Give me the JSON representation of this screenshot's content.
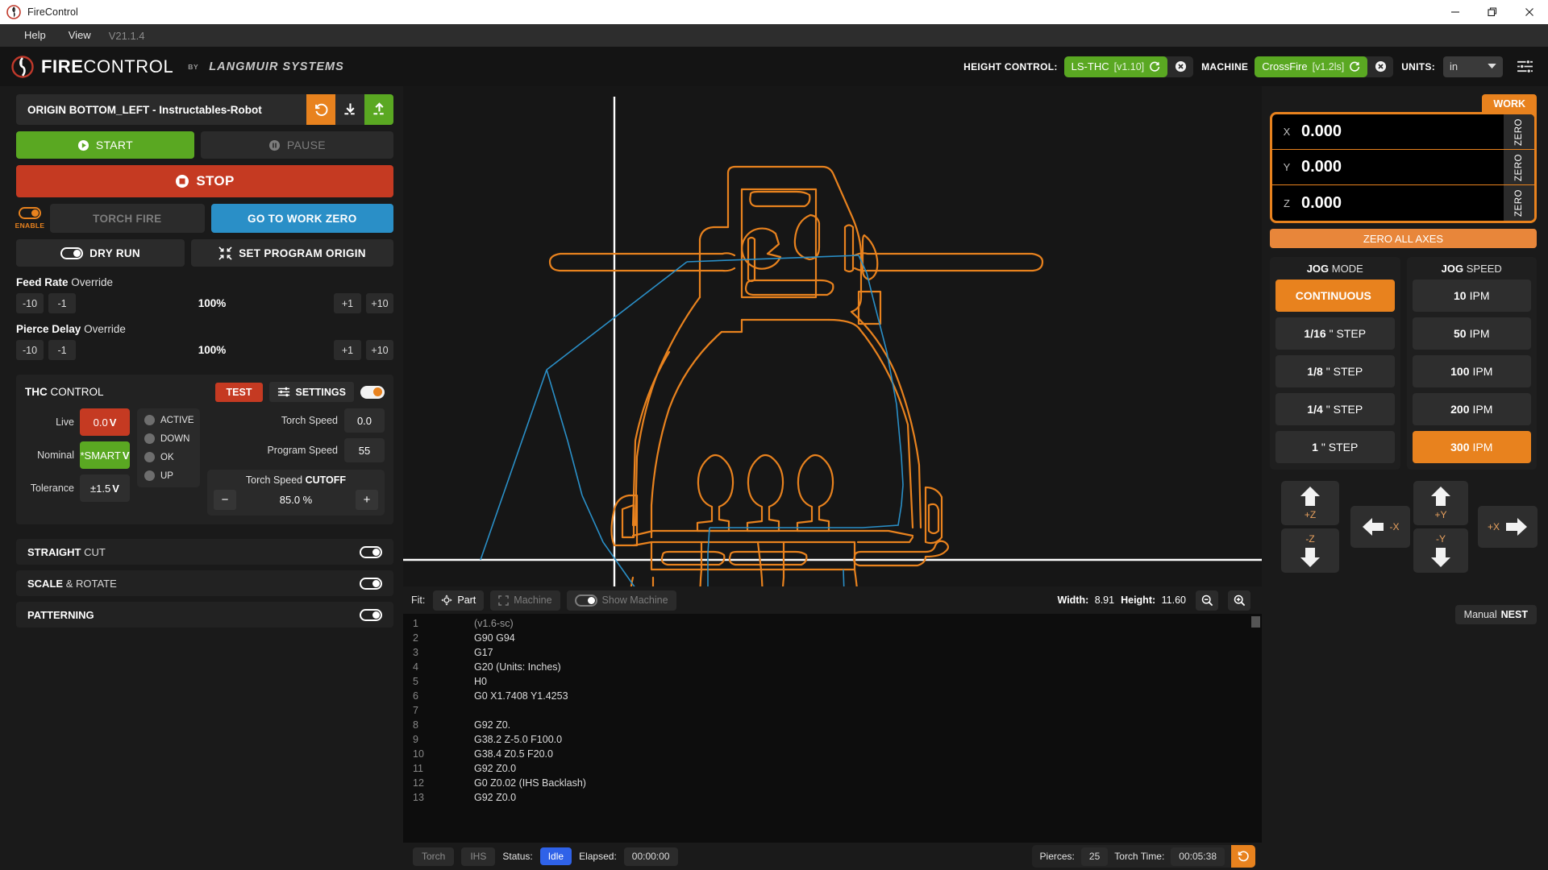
{
  "window": {
    "title": "FireControl",
    "icon": "fire-logo-icon",
    "minimize": "minimize-icon",
    "maximize": "maximize-icon",
    "close": "close-icon"
  },
  "menubar": {
    "items": [
      "Help",
      "View"
    ],
    "version": "V21.1.4"
  },
  "header": {
    "brand_fire": "FIRE",
    "brand_control": "CONTROL",
    "brand_by": "BY",
    "brand_company": "LANGMUIR SYSTEMS",
    "height_control_label": "HEIGHT CONTROL:",
    "height_control_value": "LS-THC",
    "height_control_version": "[v1.10]",
    "machine_label": "MACHINE",
    "machine_value": "CrossFire",
    "machine_version": "[v1.2ls]",
    "units_label": "UNITS:",
    "units_value": "in",
    "refresh_icon": "refresh-icon",
    "disconnect_icon": "disconnect-icon",
    "settings_icon": "sliders-icon",
    "accent_green": "#5aa822",
    "accent_orange": "#e8821e"
  },
  "left": {
    "file_name": "ORIGIN BOTTOM_LEFT - Instructables-Robot",
    "file_reset_icon": "undo-icon",
    "file_download_icon": "download-icon",
    "file_upload_icon": "upload-icon",
    "start_label": "START",
    "pause_label": "PAUSE",
    "stop_label": "STOP",
    "enable_label": "ENABLE",
    "torch_fire_label": "TORCH FIRE",
    "go_to_work_zero_label": "GO TO WORK ZERO",
    "dry_run_label": "DRY RUN",
    "set_program_origin_label": "SET PROGRAM ORIGIN",
    "feed_rate": {
      "title_bold": "Feed Rate",
      "title_rest": "Override",
      "minus10": "-10",
      "minus1": "-1",
      "value": "100%",
      "plus1": "+1",
      "plus10": "+10"
    },
    "pierce_delay": {
      "title_bold": "Pierce Delay",
      "title_rest": "Override",
      "minus10": "-10",
      "minus1": "-1",
      "value": "100%",
      "plus1": "+1",
      "plus10": "+10"
    },
    "thc": {
      "title_bold": "THC",
      "title_rest": "CONTROL",
      "test_label": "TEST",
      "settings_label": "SETTINGS",
      "live_label": "Live",
      "live_value": "0.0",
      "live_unit": "V",
      "nominal_label": "Nominal",
      "nominal_value": "*SMART",
      "nominal_unit": "V",
      "tolerance_label": "Tolerance",
      "tolerance_value": "±1.5",
      "tolerance_unit": "V",
      "leds": [
        "ACTIVE",
        "DOWN",
        "OK",
        "UP"
      ],
      "torch_speed_label": "Torch Speed",
      "torch_speed_value": "0.0",
      "program_speed_label": "Program Speed",
      "program_speed_value": "55",
      "cutoff_label": "Torch Speed",
      "cutoff_bold": "CUTOFF",
      "cutoff_minus": "−",
      "cutoff_value": "85.0 %",
      "cutoff_plus": "+"
    },
    "accordion": [
      {
        "bold": "STRAIGHT",
        "rest": "CUT"
      },
      {
        "bold": "SCALE",
        "rest": "& ROTATE"
      },
      {
        "bold": "PATTERNING",
        "rest": ""
      }
    ]
  },
  "center": {
    "toolbar": {
      "fit_label": "Fit:",
      "part_label": "Part",
      "machine_label": "Machine",
      "show_machine_label": "Show Machine",
      "width_label": "Width:",
      "width_value": "8.91",
      "height_label": "Height:",
      "height_value": "11.60",
      "zoom_out_icon": "zoom-out-icon",
      "zoom_in_icon": "zoom-in-icon"
    },
    "gcode": [
      {
        "n": "1",
        "code": "(v1.6-sc)",
        "comment": true
      },
      {
        "n": "2",
        "code": "G90 G94",
        "comment": false
      },
      {
        "n": "3",
        "code": "G17",
        "comment": false
      },
      {
        "n": "4",
        "code": "G20 (Units: Inches)",
        "comment": false
      },
      {
        "n": "5",
        "code": "H0",
        "comment": false
      },
      {
        "n": "6",
        "code": "G0 X1.7408 Y1.4253",
        "comment": false
      },
      {
        "n": "7",
        "code": "",
        "comment": false
      },
      {
        "n": "8",
        "code": "G92 Z0.",
        "comment": false
      },
      {
        "n": "9",
        "code": "G38.2 Z-5.0 F100.0",
        "comment": false
      },
      {
        "n": "10",
        "code": "G38.4 Z0.5 F20.0",
        "comment": false
      },
      {
        "n": "11",
        "code": "G92 Z0.0",
        "comment": false
      },
      {
        "n": "12",
        "code": "G0 Z0.02 (IHS Backlash)",
        "comment": false
      },
      {
        "n": "13",
        "code": "G92 Z0.0",
        "comment": false
      }
    ],
    "statusbar": {
      "torch_label": "Torch",
      "ihs_label": "IHS",
      "status_label": "Status:",
      "status_value": "Idle",
      "elapsed_label": "Elapsed:",
      "elapsed_value": "00:00:00",
      "pierces_label": "Pierces:",
      "pierces_value": "25",
      "torch_time_label": "Torch Time:",
      "torch_time_value": "00:05:38",
      "reset_icon": "undo-icon"
    },
    "preview": {
      "cut_path_color": "#e8821e",
      "rapid_path_color": "#2a8fc7",
      "axis_color": "#ffffff",
      "background": "#161616"
    }
  },
  "right": {
    "work_tab": "WORK",
    "axes": [
      {
        "axis": "X",
        "value": "0.000",
        "zero": "ZERO"
      },
      {
        "axis": "Y",
        "value": "0.000",
        "zero": "ZERO"
      },
      {
        "axis": "Z",
        "value": "0.000",
        "zero": "ZERO"
      }
    ],
    "zero_all_label": "ZERO ALL AXES",
    "jog_mode_bold": "JOG",
    "jog_mode_rest": "MODE",
    "jog_modes": [
      {
        "bold": "CONTINUOUS",
        "rest": "",
        "active": true
      },
      {
        "bold": "1/16",
        "rest": "\" STEP",
        "active": false
      },
      {
        "bold": "1/8",
        "rest": "\" STEP",
        "active": false
      },
      {
        "bold": "1/4",
        "rest": "\" STEP",
        "active": false
      },
      {
        "bold": "1",
        "rest": "\" STEP",
        "active": false
      }
    ],
    "jog_speed_bold": "JOG",
    "jog_speed_rest": "SPEED",
    "jog_speeds": [
      {
        "bold": "10",
        "rest": "IPM",
        "active": false
      },
      {
        "bold": "50",
        "rest": "IPM",
        "active": false
      },
      {
        "bold": "100",
        "rest": "IPM",
        "active": false
      },
      {
        "bold": "200",
        "rest": "IPM",
        "active": false
      },
      {
        "bold": "300",
        "rest": "IPM",
        "active": true
      }
    ],
    "jog_pad": {
      "z_up": "+Z",
      "z_down": "-Z",
      "y_up": "+Y",
      "y_down": "-Y",
      "x_minus": "-X",
      "x_plus": "+X"
    },
    "nest_label_rest": "Manual",
    "nest_label_bold": "NEST"
  }
}
